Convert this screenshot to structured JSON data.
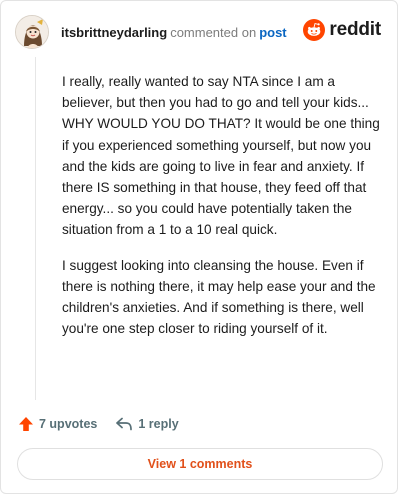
{
  "header": {
    "username": "itsbrittneydarling",
    "action_text": "commented on",
    "post_link": "post",
    "brand": "reddit",
    "avatar_icon": "cartoon-avatar",
    "brand_icon": "reddit-snoo-icon"
  },
  "comment": {
    "paragraphs": [
      "I really, really wanted to say NTA since I am a believer, but then you had to go and tell your kids... WHY WOULD YOU DO THAT? It would be one thing if you experienced something yourself, but now you and the kids are going to live in fear and anxiety. If there IS something in that house, they feed off that energy... so you could have potentially taken the situation from a 1 to a 10 real quick.",
      "I suggest looking into cleansing the house. Even if there is nothing there, it may help ease your and the children's anxieties. And if something is there, well you're one step closer to riding yourself of it."
    ]
  },
  "actions": {
    "upvotes": "7 upvotes",
    "reply": "1 reply"
  },
  "view_comments": "View 1 comments",
  "colors": {
    "reddit_orange": "#FF4500",
    "upvote": "#FF4500",
    "link": "#0a66c2",
    "view_button_text": "#e1501a"
  }
}
